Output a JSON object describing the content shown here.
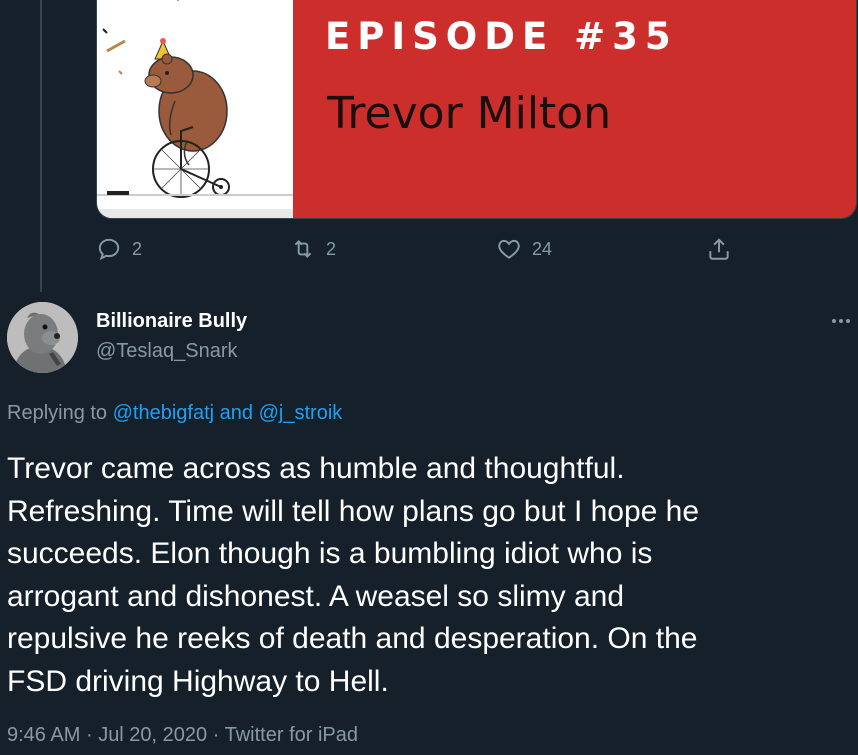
{
  "episode_card": {
    "episode_label": "EPISODE #35",
    "guest_name": "Trevor Milton"
  },
  "prev_tweet_actions": {
    "reply_count": "2",
    "retweet_count": "2",
    "like_count": "24"
  },
  "tweet": {
    "author_name": "Billionaire Bully",
    "author_handle": "@Teslaq_Snark",
    "replying_prefix": "Replying to",
    "replying_user1": "@thebigfatj",
    "replying_and": "and",
    "replying_user2": "@j_stroik",
    "text": "Trevor came across as humble and thoughtful.\nRefreshing.  Time will tell how plans go but I hope he\nsucceeds.  Elon though is a bumbling idiot who is\narrogant and dishonest.  A weasel so slimy and\nrepulsive he reeks of death and desperation.  On the\nFSD driving Highway to Hell.",
    "time": "9:46 AM",
    "date": "Jul 20, 2020",
    "source": "Twitter for iPad",
    "separator": "·"
  },
  "colors": {
    "background": "#15202b",
    "secondary_text": "#8899a6",
    "link": "#1da1f2",
    "card_red": "#cc2f2b"
  },
  "icons": [
    "reply-icon",
    "retweet-icon",
    "like-icon",
    "share-icon",
    "more-icon"
  ]
}
